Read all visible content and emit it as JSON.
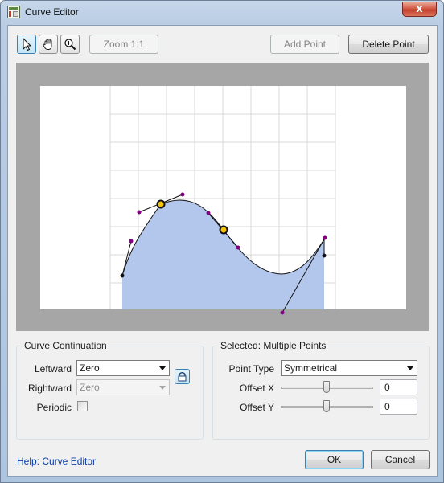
{
  "window": {
    "title": "Curve Editor",
    "close_glyph": "x"
  },
  "toolbar": {
    "tools": [
      {
        "name": "pointer-icon",
        "active": true
      },
      {
        "name": "hand-icon",
        "active": false
      },
      {
        "name": "zoom-icon",
        "active": false
      }
    ],
    "zoom_label": "Zoom 1:1",
    "add_point_label": "Add Point",
    "delete_point_label": "Delete Point"
  },
  "curve_continuation": {
    "title": "Curve Continuation",
    "leftward_label": "Leftward",
    "leftward_value": "Zero",
    "rightward_label": "Rightward",
    "rightward_value": "Zero",
    "periodic_label": "Periodic",
    "periodic_checked": false,
    "lock_icon": "lock-icon"
  },
  "selected": {
    "title": "Selected: Multiple Points",
    "point_type_label": "Point Type",
    "point_type_value": "Symmetrical",
    "offset_x_label": "Offset X",
    "offset_x_value": "0",
    "offset_y_label": "Offset Y",
    "offset_y_value": "0"
  },
  "footer": {
    "help_label": "Help: Curve Editor",
    "ok_label": "OK",
    "cancel_label": "Cancel"
  },
  "colors": {
    "curve_fill": "#b3c6ec",
    "handle_point": "#800080",
    "selected_point": "#f5c400",
    "canvas_bg": "#a6a6a6",
    "link": "#0b3ea8"
  }
}
